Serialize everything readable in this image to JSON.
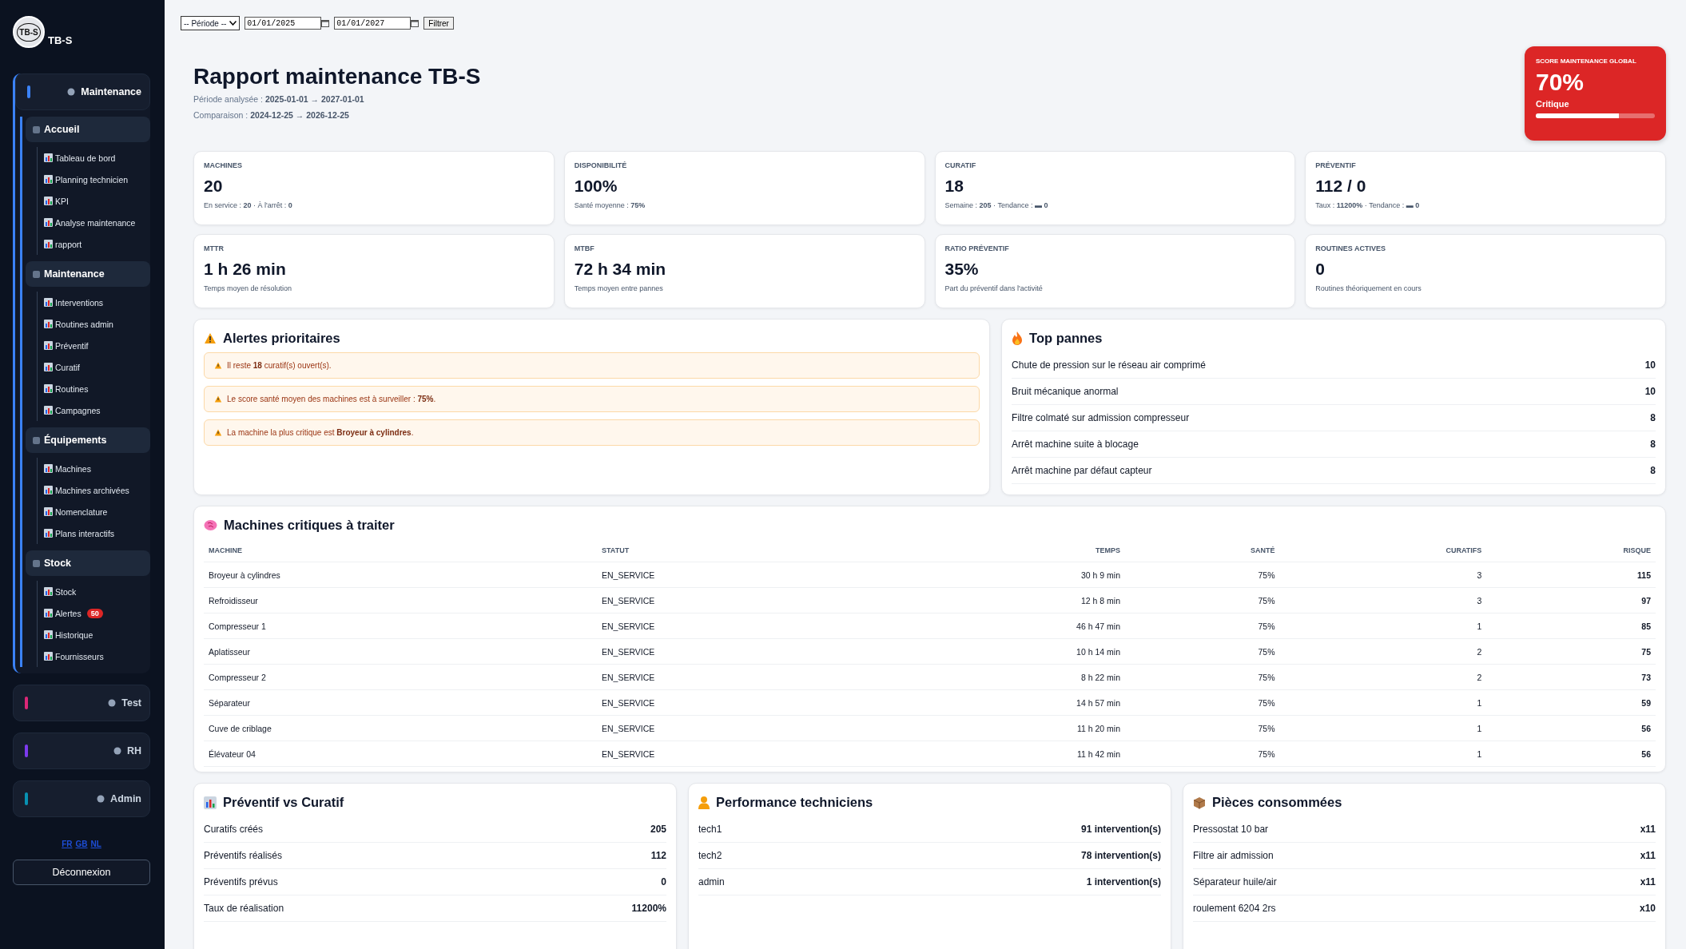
{
  "sidebar": {
    "brand": "TB-S",
    "logo_text": "TB-S",
    "groups": [
      {
        "label": "Maintenance",
        "color": "#3b82f6",
        "expanded": true,
        "sections": [
          {
            "label": "Accueil",
            "items": [
              {
                "label": "Tableau de bord"
              },
              {
                "label": "Planning technicien"
              },
              {
                "label": "KPI"
              },
              {
                "label": "Analyse maintenance"
              },
              {
                "label": "rapport"
              }
            ]
          },
          {
            "label": "Maintenance",
            "items": [
              {
                "label": "Interventions"
              },
              {
                "label": "Routines admin"
              },
              {
                "label": "Préventif"
              },
              {
                "label": "Curatif"
              },
              {
                "label": "Routines"
              },
              {
                "label": "Campagnes"
              }
            ]
          },
          {
            "label": "Équipements",
            "items": [
              {
                "label": "Machines"
              },
              {
                "label": "Machines archivées"
              },
              {
                "label": "Nomenclature"
              },
              {
                "label": "Plans interactifs"
              }
            ]
          },
          {
            "label": "Stock",
            "items": [
              {
                "label": "Stock"
              },
              {
                "label": "Alertes",
                "badge": "50"
              },
              {
                "label": "Historique"
              },
              {
                "label": "Fournisseurs"
              }
            ]
          }
        ]
      },
      {
        "label": "Test",
        "color": "#db2777",
        "expanded": false
      },
      {
        "label": "RH",
        "color": "#7c3aed",
        "expanded": false
      },
      {
        "label": "Admin",
        "color": "#0891b2",
        "expanded": false
      }
    ],
    "languages": [
      "FR",
      "GB",
      "NL"
    ],
    "logout": "Déconnexion"
  },
  "filter": {
    "period": "-- Période --",
    "date_from": "01/01/2025",
    "date_to": "01/01/2027",
    "button": "Filtrer"
  },
  "header": {
    "title": "Rapport maintenance TB-S",
    "period": "Période analysée : **2025-01-01 → 2027-01-01**",
    "comparison": "Comparaison : **2024-12-25 → 2026-12-25**"
  },
  "score": {
    "label": "SCORE MAINTENANCE GLOBAL",
    "value": "70%",
    "status": "Critique",
    "level": 0.7
  },
  "stats": [
    {
      "label": "MACHINES",
      "value": "20",
      "note": "En service : **20** · À l'arrêt : **0**"
    },
    {
      "label": "DISPONIBILITÉ",
      "value": "100%",
      "note": "Santé moyenne : **75%**"
    },
    {
      "label": "CURATIF",
      "value": "18",
      "note": "Semaine : **205** · Tendance : **▬ 0**"
    },
    {
      "label": "PRÉVENTIF",
      "value": "112 / 0",
      "note": "Taux : **11200%** · Tendance : **▬ 0**"
    },
    {
      "label": "MTTR",
      "value": "1 h 26 min",
      "note": "Temps moyen de résolution"
    },
    {
      "label": "MTBF",
      "value": "72 h 34 min",
      "note": "Temps moyen entre pannes"
    },
    {
      "label": "RATIO PRÉVENTIF",
      "value": "35%",
      "note": "Part du préventif dans l'activité"
    },
    {
      "label": "ROUTINES ACTIVES",
      "value": "0",
      "note": "Routines théoriquement en cours"
    }
  ],
  "alerts": {
    "title": "Alertes prioritaires",
    "items": [
      "Il reste **18** curatif(s) ouvert(s).",
      "Le score santé moyen des machines est à surveiller : **75%**.",
      "La machine la plus critique est **Broyeur à cylindres**."
    ]
  },
  "top_failures": {
    "title": "Top pannes",
    "items": [
      {
        "label": "Chute de pression sur le réseau air comprimé",
        "count": "10"
      },
      {
        "label": "Bruit mécanique anormal",
        "count": "10"
      },
      {
        "label": "Filtre colmaté sur admission compresseur",
        "count": "8"
      },
      {
        "label": "Arrêt machine suite à blocage",
        "count": "8"
      },
      {
        "label": "Arrêt machine par défaut capteur",
        "count": "8"
      }
    ]
  },
  "critical_machines": {
    "title": "Machines critiques à traiter",
    "columns": [
      "MACHINE",
      "STATUT",
      "TEMPS",
      "SANTÉ",
      "CURATIFS",
      "RISQUE"
    ],
    "rows": [
      [
        "Broyeur à cylindres",
        "EN_SERVICE",
        "30 h 9 min",
        "75%",
        "3",
        "115"
      ],
      [
        "Refroidisseur",
        "EN_SERVICE",
        "12 h 8 min",
        "75%",
        "3",
        "97"
      ],
      [
        "Compresseur 1",
        "EN_SERVICE",
        "46 h 47 min",
        "75%",
        "1",
        "85"
      ],
      [
        "Aplatisseur",
        "EN_SERVICE",
        "10 h 14 min",
        "75%",
        "2",
        "75"
      ],
      [
        "Compresseur 2",
        "EN_SERVICE",
        "8 h 22 min",
        "75%",
        "2",
        "73"
      ],
      [
        "Séparateur",
        "EN_SERVICE",
        "14 h 57 min",
        "75%",
        "1",
        "59"
      ],
      [
        "Cuve de criblage",
        "EN_SERVICE",
        "11 h 20 min",
        "75%",
        "1",
        "56"
      ],
      [
        "Élévateur 04",
        "EN_SERVICE",
        "11 h 42 min",
        "75%",
        "1",
        "56"
      ]
    ]
  },
  "bottom_panels": [
    {
      "title": "Préventif vs Curatif",
      "rows": [
        {
          "label": "Curatifs créés",
          "value": "205"
        },
        {
          "label": "Préventifs réalisés",
          "value": "112"
        },
        {
          "label": "Préventifs prévus",
          "value": "0"
        },
        {
          "label": "Taux de réalisation",
          "value": "11200%"
        }
      ]
    },
    {
      "title": "Performance techniciens",
      "rows": [
        {
          "label": "tech1",
          "value": "91 intervention(s)"
        },
        {
          "label": "tech2",
          "value": "78 intervention(s)"
        },
        {
          "label": "admin",
          "value": "1 intervention(s)"
        }
      ]
    },
    {
      "title": "Pièces consommées",
      "rows": [
        {
          "label": "Pressostat 10 bar",
          "value": "x11"
        },
        {
          "label": "Filtre air admission",
          "value": "x11"
        },
        {
          "label": "Séparateur huile/air",
          "value": "x11"
        },
        {
          "label": "roulement 6204 2rs",
          "value": "x10"
        }
      ]
    }
  ]
}
